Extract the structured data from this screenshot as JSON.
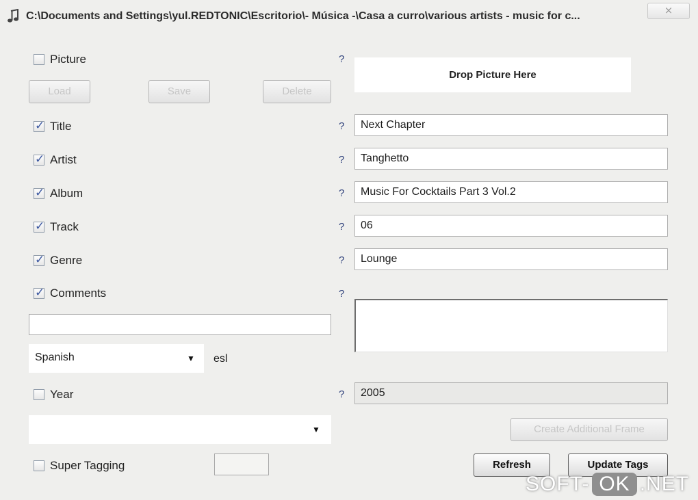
{
  "window": {
    "title": "C:\\Documents and Settings\\yul.REDTONIC\\Escritorio\\- Música -\\Casa a curro\\various artists - music for c...",
    "title_icon": "music-note-icon",
    "close_glyph": "⨯"
  },
  "picture": {
    "label": "Picture",
    "checked": false,
    "help": "?",
    "drop_text": "Drop Picture Here",
    "load_label": "Load",
    "save_label": "Save",
    "delete_label": "Delete"
  },
  "fields": {
    "title": {
      "label": "Title",
      "checked": true,
      "help": "?",
      "value": "Next Chapter"
    },
    "artist": {
      "label": "Artist",
      "checked": true,
      "help": "?",
      "value": "Tanghetto"
    },
    "album": {
      "label": "Album",
      "checked": true,
      "help": "?",
      "value": "Music For Cocktails Part 3 Vol.2"
    },
    "track": {
      "label": "Track",
      "checked": true,
      "help": "?",
      "value": "06"
    },
    "genre": {
      "label": "Genre",
      "checked": true,
      "help": "?",
      "value": "Lounge"
    },
    "comments": {
      "label": "Comments",
      "checked": true,
      "help": "?",
      "value": ""
    }
  },
  "comment_description": {
    "value": ""
  },
  "language": {
    "selected": "Spanish",
    "code": "esl"
  },
  "year": {
    "label": "Year",
    "checked": false,
    "help": "?",
    "value": "2005"
  },
  "frame_select": {
    "selected": ""
  },
  "create_frame_label": "Create Additional Frame",
  "super_tagging": {
    "label": "Super Tagging",
    "checked": false,
    "value": ""
  },
  "buttons": {
    "refresh": "Refresh",
    "update": "Update Tags"
  },
  "watermark": {
    "left": "SOFT-",
    "ok": "OK",
    "right": ".NET"
  },
  "colors": {
    "window_bg": "#efefed",
    "help_mark": "#2d3f7a",
    "check": "#3b57a0"
  }
}
